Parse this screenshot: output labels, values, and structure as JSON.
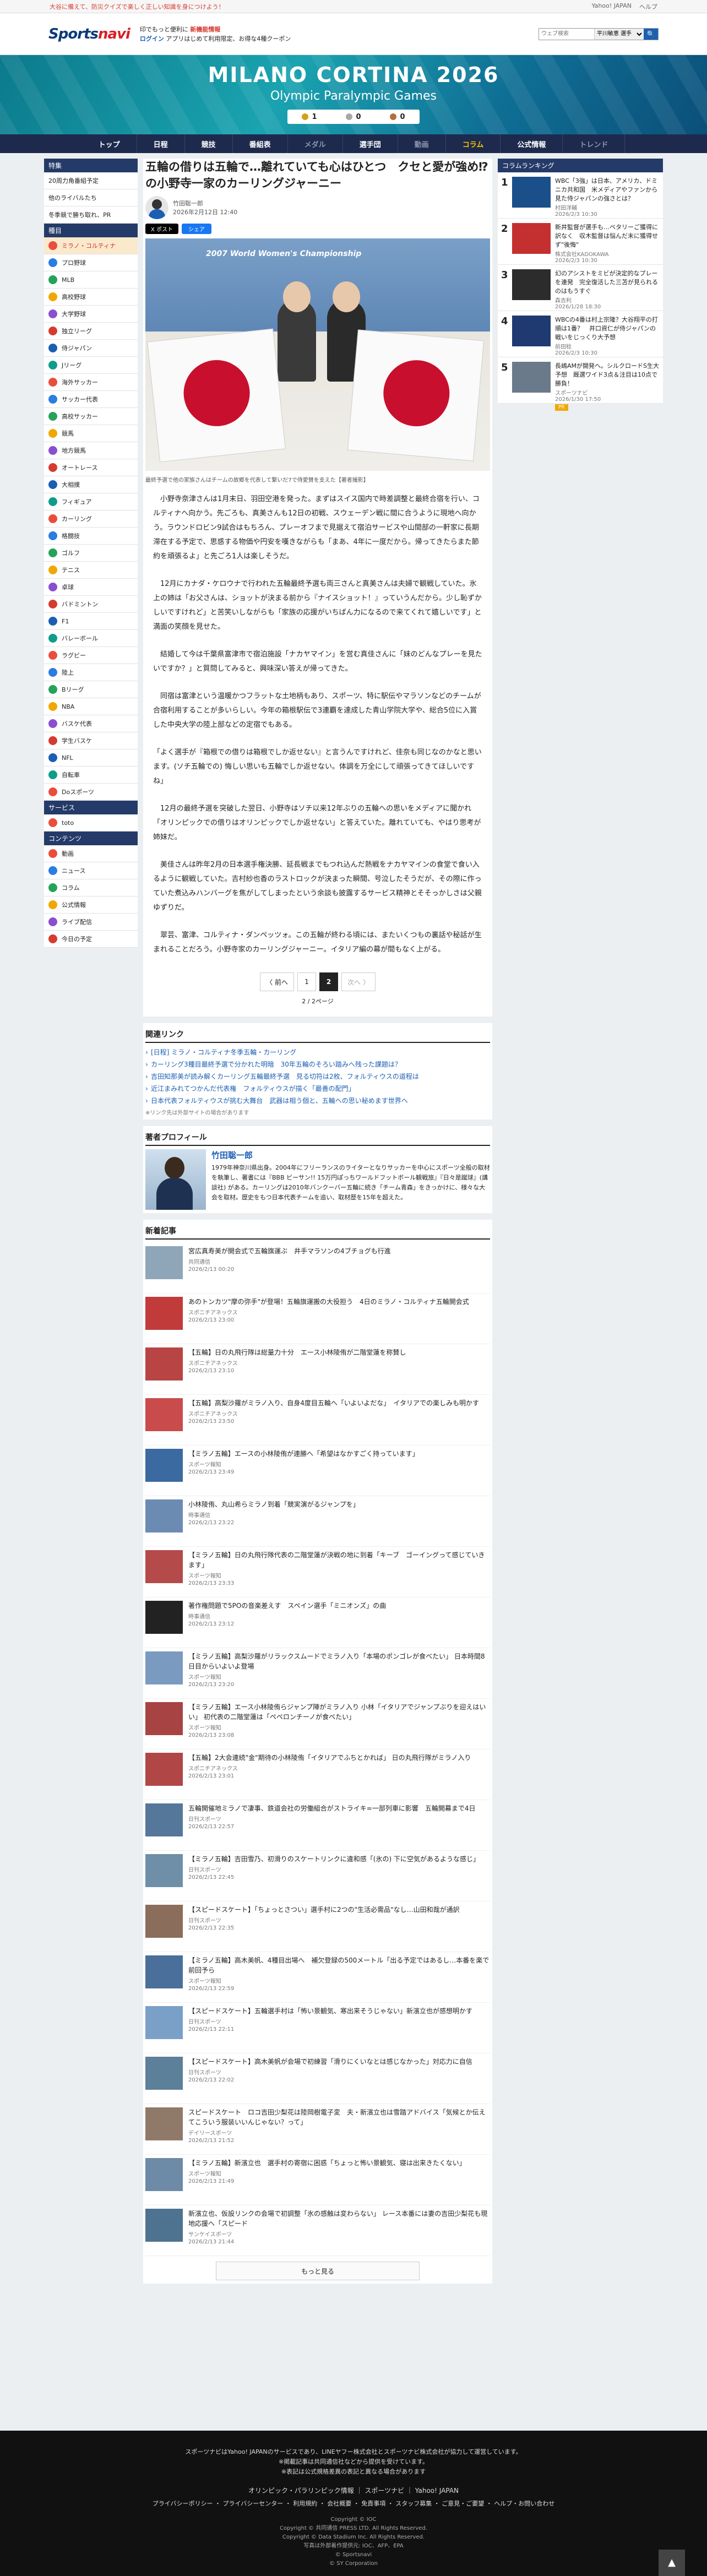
{
  "topbar": {
    "promo": "大谷に備えて、防災クイズで楽しく正しい知識を身につけよう！",
    "links": [
      "Yahoo! JAPAN",
      "ヘルプ"
    ]
  },
  "header": {
    "logo_a": "Sports",
    "logo_b": "navi",
    "promo1": "印でもっと便利に",
    "promo1b": "新機能情報",
    "promo2": "ログイン",
    "promo2b": "アプリはじめて利用限定、お得な4種クーポン",
    "search_placeholder": "ウェブ検索",
    "search_scope": "平川敏恵 選手",
    "search_btn": "🔍"
  },
  "banner": {
    "title": "MILANO CORTINA 2026",
    "subtitle": "Olympic Paralympic Games",
    "medals": [
      "1",
      "0",
      "0"
    ]
  },
  "nav": [
    "トップ",
    "日程",
    "競技",
    "番組表",
    "メダル",
    "選手団",
    "動画",
    "コラム",
    "公式情報",
    "トレンド"
  ],
  "left_sidebar": {
    "head1": "特集",
    "feature": [
      "20周力角番組予定",
      "他のライバルたち",
      "冬季競で勝ち取れ、PR"
    ],
    "head2": "種目",
    "sports": [
      "ミラノ・コルティナ",
      "プロ野球",
      "MLB",
      "高校野球",
      "大学野球",
      "独立リーグ",
      "侍ジャパン",
      "Jリーグ",
      "海外サッカー",
      "サッカー代表",
      "高校サッカー",
      "競馬",
      "地方競馬",
      "オートレース",
      "大相撲",
      "フィギュア",
      "カーリング",
      "格闘技",
      "ゴルフ",
      "テニス",
      "卓球",
      "バドミントン",
      "F1",
      "バレーボール",
      "ラグビー",
      "陸上",
      "Bリーグ",
      "NBA",
      "バスケ代表",
      "学生バスケ",
      "NFL",
      "自転車",
      "Doスポーツ"
    ],
    "head3": "サービス",
    "services": [
      "toto"
    ],
    "head4": "コンテンツ",
    "contents": [
      "動画",
      "ニュース",
      "コラム",
      "公式情報",
      "ライブ配信",
      "今日の予定"
    ]
  },
  "article": {
    "title": "五輪の借りは五輪で…離れていても心はひとつ　クセと愛が強め⁉の小野寺一家のカーリングジャーニー",
    "author": "竹田聡一郎",
    "date": "2026年2月12日 12:40",
    "share_x": "X ポスト",
    "share_f": "シェア",
    "photo_sign": "2007 World Women's Championship",
    "caption": "最終予選で他の家族さんはチームの故郷を代表して繋いだ7で侍愛賛を支えた【著者撮影】",
    "paragraphs": [
      "　小野寺奈津さんは1月末日、羽田空港を発った。まずはスイス国内で時差調整と最終合宿を行い、コルティナへ向かう。先ごろも、真美さんも12日の初戦、スウェーデン戦に間に合うように現地へ向かう。ラウンドロビン9試合はもちろん、プレーオフまで見据えて宿泊サービスや山間部の一軒家に長期滞在する予定で、思惑する物価や円安を嘆きながらも「まあ、4年に一度だから。帰ってきたらまた節約を頑張るよ」と先ごろ1人は楽しそうだ。",
      "　12月にカナダ・ケロウナで行われた五輪最終予選も両三さんと真美さんは夫婦で観戦していた。氷上の姉は「お父さんは、ショットが決まる前から『ナイスショット！』っていうんだから。少し恥ずかしいですけれど」と苦笑いしながらも「家族の応援がいちばん力になるので来てくれて嬉しいです」と満面の笑顔を見せた。",
      "　結婚して今は千葉県富津市で宿泊施設「ナカヤマイン」を営む真佳さんに「妹のどんなプレーを見たいですか？」と質問してみると、興味深い答えが帰ってきた。",
      "　同宿は富津という温暖かつフラットな土地柄もあり、スポーツ、特に駅伝やマラソンなどのチームが合宿利用することが多いらしい。今年の箱根駅伝で3連覇を達成した青山学院大学や、総合5位に入賞した中央大学の陸上部などの定宿でもある。",
      "「よく選手が『箱根での借りは箱根でしか返せない』と言うんですけれど、佳奈も同じなのかなと思います。(ソチ五輪での) 悔しい思いも五輪でしか返せない。体調を万全にして頑張ってきてほしいですね」",
      "　12月の最終予選を突破した翌日、小野寺はソチ以来12年ぶりの五輪への思いをメディアに聞かれ「オリンピックでの借りはオリンピックでしか返せない」と答えていた。離れていても、やはり思考が姉妹だ。",
      "　美佳さんは昨年2月の日本選手権決勝、延長戦までもつれ込んだ熱戦をナカヤマインの食堂で食い入るように観戦していた。吉村紗也香のラストロックが決まった瞬間、号泣したそうだが、その際に作っていた煮込みハンバーグを焦がしてしまったという余談も披露するサービス精神とそそっかしさは父親ゆずりだ。",
      "　翠芸、富津、コルティナ・ダンペッツォ。この五輪が終わる頃には、またいくつもの裏話や秘話が生まれることだろう。小野寺家のカーリングジャーニー。イタリア編の幕が間もなく上がる。"
    ]
  },
  "pager": {
    "prev": "〈 前へ",
    "pages": [
      "1",
      "2"
    ],
    "current": "2",
    "next": "次へ 〉",
    "info": "2 / 2ページ"
  },
  "related": {
    "title": "関連リンク",
    "links": [
      "[日程] ミラノ・コルティナ冬季五輪・カーリング",
      "カーリング3種目最終予選で分かれた明暗　30年五輪のそろい踏みへ残った課題は？",
      "吉田知那美が読み解くカーリング五輪最終予選　見る切符は2枚、フォルティウスの道程は",
      "近江まみれてつかんだ代表権　フォルティウスが描く「最善の配門」",
      "日本代表フォルティウスが挑む大舞台　武器は相う個と、五輪への思い秘めます世界へ"
    ],
    "note": "※リンク先は外部サイトの場合があります"
  },
  "profile": {
    "title": "著者プロフィール",
    "name": "竹田聡一郎",
    "bio": "1979年神奈川県出身。2004年にフリーランスのライターとなりサッカーを中心にスポーツ全般の取材を執筆し、著書には『BBB ビーサン!! 15万円ぽっちワールドフットボール観戦旅』『日々是蹴球』(講談社) がある。カーリングは2010年バンクーバー五輪に続き「チーム青森」をきっかけに、様々な大会を取材。歴史をもつ日本代表チームを追い、取材歴を15年を超えた。"
  },
  "latest": {
    "title": "新着記事",
    "items": [
      {
        "t": "宮広真寿美が開会式で五輪旗運ぶ　井手マラソンの4ブチョグも行進",
        "s": "共同通信",
        "d": "2026/2/13 00:20"
      },
      {
        "t": "あのトンカツ\"摩の弥手\"が登場！五輪旗運搬の大役担う　4日のミラノ・コルティナ五輪開会式",
        "s": "スポニチアネックス",
        "d": "2026/2/13 23:00"
      },
      {
        "t": "【五輪】日の丸飛行隊は総量力十分　エース小林陵侑が二階堂蓮を称賛し",
        "s": "スポニチアネックス",
        "d": "2026/2/13 23:10"
      },
      {
        "t": "【五輪】高梨沙羅がミラノ入り、自身4度目五輪へ「いよいよだな」　イタリアでの楽しみも明かす",
        "s": "スポニチアネックス",
        "d": "2026/2/13 23:50"
      },
      {
        "t": "【ミラノ五輪】エースの小林陵侑が連勝へ「希望はなかすごく持っています」",
        "s": "スポーツ報知",
        "d": "2026/2/13 23:49"
      },
      {
        "t": "小林陵侑、丸山希らミラノ到着「競実演がるジャンプを」",
        "s": "時事通信",
        "d": "2026/2/13 23:22"
      },
      {
        "t": "【ミラノ五輪】日の丸飛行隊代表の二階堂蓮が決戦の地に到着「キーブ　ゴーイングって感じていきます」",
        "s": "スポーツ報知",
        "d": "2026/2/13 23:33"
      },
      {
        "t": "著作権問題で5POの音楽差えす　スペイン選手「ミニオンズ」の曲",
        "s": "時事通信",
        "d": "2026/2/13 23:12"
      },
      {
        "t": "【ミラノ五輪】高梨沙羅がリラックスムードでミラノ入り「本場のポンゴレが食べたい」 日本時間8日目からいよいよ登場",
        "s": "スポーツ報知",
        "d": "2026/2/13 23:20"
      },
      {
        "t": "【ミラノ五輪】エース小林陵侑らジャンプ陣がミラノ入り 小林「イタリアでジャンプぶりを迎えはいい」 初代表の二階堂蓮は「ペペロンチーノが食べたい」",
        "s": "スポーツ報知",
        "d": "2026/2/13 23:08"
      },
      {
        "t": "【五輪】2大会連続\"金\"期待の小林陵侑「イタリアでふちとかれば」 日の丸飛行隊がミラノ入り",
        "s": "スポニチアネックス",
        "d": "2026/2/13 23:01"
      },
      {
        "t": "五輪開催地ミラノで凄事、鉄道会社の労働組合がストライキ=一部列車に影響　五輪開幕まで4日",
        "s": "日刊スポーツ",
        "d": "2026/2/13 22:57"
      },
      {
        "t": "【ミラノ五輪】吉田雪乃、初滑りのスケートリンクに違和感「(氷の) 下に空気があるような感じ」",
        "s": "日刊スポーツ",
        "d": "2026/2/13 22:45"
      },
      {
        "t": "【スピードスケート】「ちょっとさつい」選手村に2つの\"生活必需品\"なし…山田和哉が通訳",
        "s": "日刊スポーツ",
        "d": "2026/2/13 22:35"
      },
      {
        "t": "【ミラノ五輪】高木美帆、4種目出場へ　補欠登録の500メートル「出る予定ではあるし…本番を楽で前回予ら",
        "s": "スポーツ報知",
        "d": "2026/2/13 22:59"
      },
      {
        "t": "【スピードスケート】五輪選手村は「怖い景観気、寒出来そうじゃない」新濱立也が感想明かす",
        "s": "日刊スポーツ",
        "d": "2026/2/13 22:11"
      },
      {
        "t": "【スピードスケート】高木美帆が会場で初練習「滑りにくいなとは感じなかった」対応力に自信",
        "s": "日刊スポーツ",
        "d": "2026/2/13 22:02"
      },
      {
        "t": "スピードスケート　ロコ吉田少梨花は陸岡樹電子変　夫・新濱立也は雪踏アドバイス「気候とか伝えてこういう服装いいんじゃない？って」",
        "s": "デイリースポーツ",
        "d": "2026/2/13 21:52"
      },
      {
        "t": "【ミラノ五輪】新濱立也　選手村の寄宿に困惑「ちょっと怖い景観気、寝は出来きたくない」",
        "s": "スポーツ報知",
        "d": "2026/2/13 21:49"
      },
      {
        "t": "新濱立也、仮設リンクの会場で初調整「氷の感触は変わらない」 レース本番には妻の吉田少梨花も現地応援へ「スピード",
        "s": "サンケイスポーツ",
        "d": "2026/2/13 21:44"
      }
    ],
    "more": "もっと見る"
  },
  "ranking": {
    "title": "コラムランキング",
    "items": [
      {
        "t": "WBC「3強」は日本、アメリカ、ドミニカ共和国　米メディアやファンから見た侍ジャパンの強さとは？",
        "s": "村田洋輔",
        "d": "2026/2/3 10:30"
      },
      {
        "t": "新井監督が選手も…ベタリーご獲得に訳なく　収木監督は悩んだ末に獲得せず\"後悔\"",
        "s": "株式会社KADOKAWA",
        "d": "2026/2/3 10:30"
      },
      {
        "t": "幻のアシストをミビが決定的なプレーを連発　完全復活した三苫が見られるのはもうすぐ",
        "s": "森吉利",
        "d": "2026/1/28 18:30"
      },
      {
        "t": "WBCの4番は村上宗隆？大谷翔平の打順は1番？　井口資仁が侍ジャパンの戦いをじっくり大予想",
        "s": "前田稔",
        "d": "2026/2/3 10:30"
      },
      {
        "t": "長嶋AMが開発へ。シルクロードS生大予想　厩選ワイド3点＆注目は10点で勝負！",
        "s": "スポーツナビ",
        "d": "2026/1/30 17:50",
        "badge": "PR"
      }
    ]
  },
  "footer": {
    "line1": "スポーツナビはYahoo! JAPANのサービスであり、LINEヤフー株式会社とスポーツナビ株式会社が協力して運営しています。",
    "line2": "※掲載記事は共同通信社などから提供を受けています。",
    "line3": "※表記は公式規格差異の表記と異なる場合があります",
    "links": "オリンピック・パラリンピック情報 ｜ スポーツナビ ｜ Yahoo! JAPAN",
    "links2": "プライバシーポリシー ・ プライバシーセンター ・ 利用規約 ・ 会社概要 ・ 免責事項 ・ スタッフ募集 ・ ご意見・ご要望 ・ ヘルプ・お問い合わせ",
    "copy1": "Copyright © IOC",
    "copy2": "Copyright © 共同通信 PRESS LTD. All Rights Reserved.",
    "copy3": "Copyright © Data Stadium Inc. All Rights Reserved.",
    "copy4": "写真は外部着作提供元: IOC、AFP、EPA",
    "copy5": "© Sportsnavi",
    "copy6": "© SY Corporation",
    "totop": "▲"
  }
}
